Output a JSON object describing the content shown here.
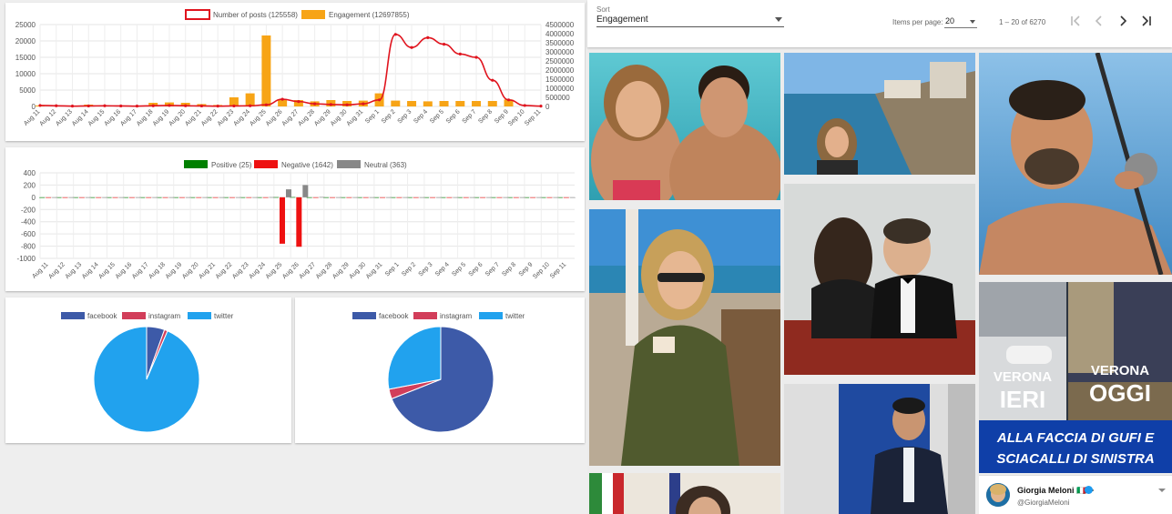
{
  "dashboard": {
    "timeline": {
      "legend": {
        "posts": "Number of posts (125558)",
        "engagement": "Engagement (12697855)"
      },
      "colors": {
        "posts": "#e0141e",
        "engagement": "#f7a416"
      }
    },
    "sentiment": {
      "legend": {
        "positive": "Positive (25)",
        "negative": "Negative (1642)",
        "neutral": "Neutral (363)"
      },
      "colors": {
        "positive": "#008000",
        "negative": "#ee1111",
        "neutral": "#888888"
      }
    },
    "pies": {
      "legend": {
        "facebook": "facebook",
        "instagram": "instagram",
        "twitter": "twitter"
      },
      "colors": {
        "facebook": "#3d5aa8",
        "instagram": "#d23e5a",
        "twitter": "#21a2ee"
      }
    }
  },
  "chart_data": [
    {
      "type": "bar",
      "categories": [
        "Aug 11",
        "Aug 12",
        "Aug 13",
        "Aug 14",
        "Aug 15",
        "Aug 16",
        "Aug 17",
        "Aug 18",
        "Aug 19",
        "Aug 20",
        "Aug 21",
        "Aug 22",
        "Aug 23",
        "Aug 24",
        "Aug 25",
        "Aug 26",
        "Aug 27",
        "Aug 28",
        "Aug 29",
        "Aug 30",
        "Aug 31",
        "Sep 1",
        "Sep 2",
        "Sep 3",
        "Sep 4",
        "Sep 5",
        "Sep 6",
        "Sep 7",
        "Sep 8",
        "Sep 9",
        "Sep 10",
        "Sep 11"
      ],
      "series": [
        {
          "name": "Number of posts (125558)",
          "type": "line",
          "axis": "left",
          "values": [
            300,
            200,
            100,
            150,
            200,
            150,
            100,
            200,
            300,
            200,
            150,
            100,
            150,
            200,
            500,
            2200,
            1500,
            800,
            600,
            500,
            800,
            2000,
            22000,
            18000,
            21000,
            19000,
            16000,
            15000,
            8000,
            2000,
            300,
            100
          ]
        },
        {
          "name": "Engagement (12697855)",
          "type": "bar",
          "axis": "right",
          "values": [
            50000,
            40000,
            40000,
            100000,
            50000,
            50000,
            50000,
            200000,
            220000,
            200000,
            130000,
            80000,
            500000,
            720000,
            3900000,
            400000,
            350000,
            280000,
            350000,
            300000,
            320000,
            720000,
            320000,
            300000,
            280000,
            300000,
            300000,
            300000,
            300000,
            380000,
            0,
            0
          ]
        }
      ],
      "ylim_left": [
        0,
        25000
      ],
      "yticks_left": [
        0,
        5000,
        10000,
        15000,
        20000,
        25000
      ],
      "ylim_right": [
        0,
        4500000
      ],
      "yticks_right": [
        0,
        500000,
        1000000,
        1500000,
        2000000,
        2500000,
        3000000,
        3500000,
        4000000,
        4500000
      ],
      "grid": true,
      "legend": "top"
    },
    {
      "type": "bar",
      "categories": [
        "Aug 11",
        "Aug 12",
        "Aug 13",
        "Aug 14",
        "Aug 15",
        "Aug 16",
        "Aug 17",
        "Aug 18",
        "Aug 19",
        "Aug 20",
        "Aug 21",
        "Aug 22",
        "Aug 23",
        "Aug 24",
        "Aug 25",
        "Aug 26",
        "Aug 27",
        "Aug 28",
        "Aug 29",
        "Aug 30",
        "Aug 31",
        "Sep 1",
        "Sep 2",
        "Sep 3",
        "Sep 4",
        "Sep 5",
        "Sep 6",
        "Sep 7",
        "Sep 8",
        "Sep 9",
        "Sep 10",
        "Sep 11"
      ],
      "series": [
        {
          "name": "Positive (25)",
          "values": [
            0,
            0,
            0,
            0,
            0,
            0,
            0,
            0,
            0,
            0,
            0,
            0,
            0,
            0,
            2,
            3,
            0,
            0,
            0,
            0,
            0,
            0,
            0,
            0,
            0,
            0,
            0,
            0,
            0,
            0,
            0,
            0
          ]
        },
        {
          "name": "Negative (1642)",
          "values": [
            -4,
            -3,
            -2,
            -4,
            -3,
            -5,
            -3,
            -4,
            -2,
            0,
            0,
            0,
            -4,
            -5,
            -760,
            -810,
            -6,
            0,
            0,
            0,
            0,
            0,
            0,
            0,
            0,
            0,
            0,
            0,
            0,
            0,
            0,
            0
          ]
        },
        {
          "name": "Neutral (363)",
          "values": [
            0,
            0,
            0,
            0,
            0,
            0,
            0,
            0,
            0,
            0,
            0,
            0,
            0,
            2,
            130,
            200,
            4,
            0,
            0,
            0,
            0,
            0,
            0,
            0,
            0,
            0,
            0,
            0,
            0,
            0,
            0,
            0
          ]
        }
      ],
      "ylim": [
        -1000,
        400
      ],
      "yticks": [
        400,
        200,
        0,
        -200,
        -400,
        -600,
        -800,
        -1000
      ],
      "grid": true,
      "legend": "top"
    },
    {
      "type": "pie",
      "labels": [
        "facebook",
        "instagram",
        "twitter"
      ],
      "values": [
        5.5,
        1.0,
        93.5
      ],
      "legend": "top"
    },
    {
      "type": "pie",
      "labels": [
        "facebook",
        "instagram",
        "twitter"
      ],
      "values": [
        69,
        3,
        28
      ],
      "legend": "top"
    }
  ],
  "gallery": {
    "sort_label": "Sort",
    "sort_value": "Engagement",
    "items_per_page_label": "Items per page:",
    "items_per_page_value": "20",
    "range_label": "1 – 20 of 6270",
    "poster_text": {
      "left_top": "VERONA",
      "left_big": "IERI",
      "right_top": "VERONA",
      "right_big": "OGGI",
      "banner_line1": "ALLA FACCIA DI GUFI E",
      "banner_line2": "SCIACALLI DI SINISTRA"
    },
    "tweet": {
      "name": "Giorgia Meloni 🇮🇹 >",
      "handle": "@GiorgiaMeloni"
    }
  }
}
